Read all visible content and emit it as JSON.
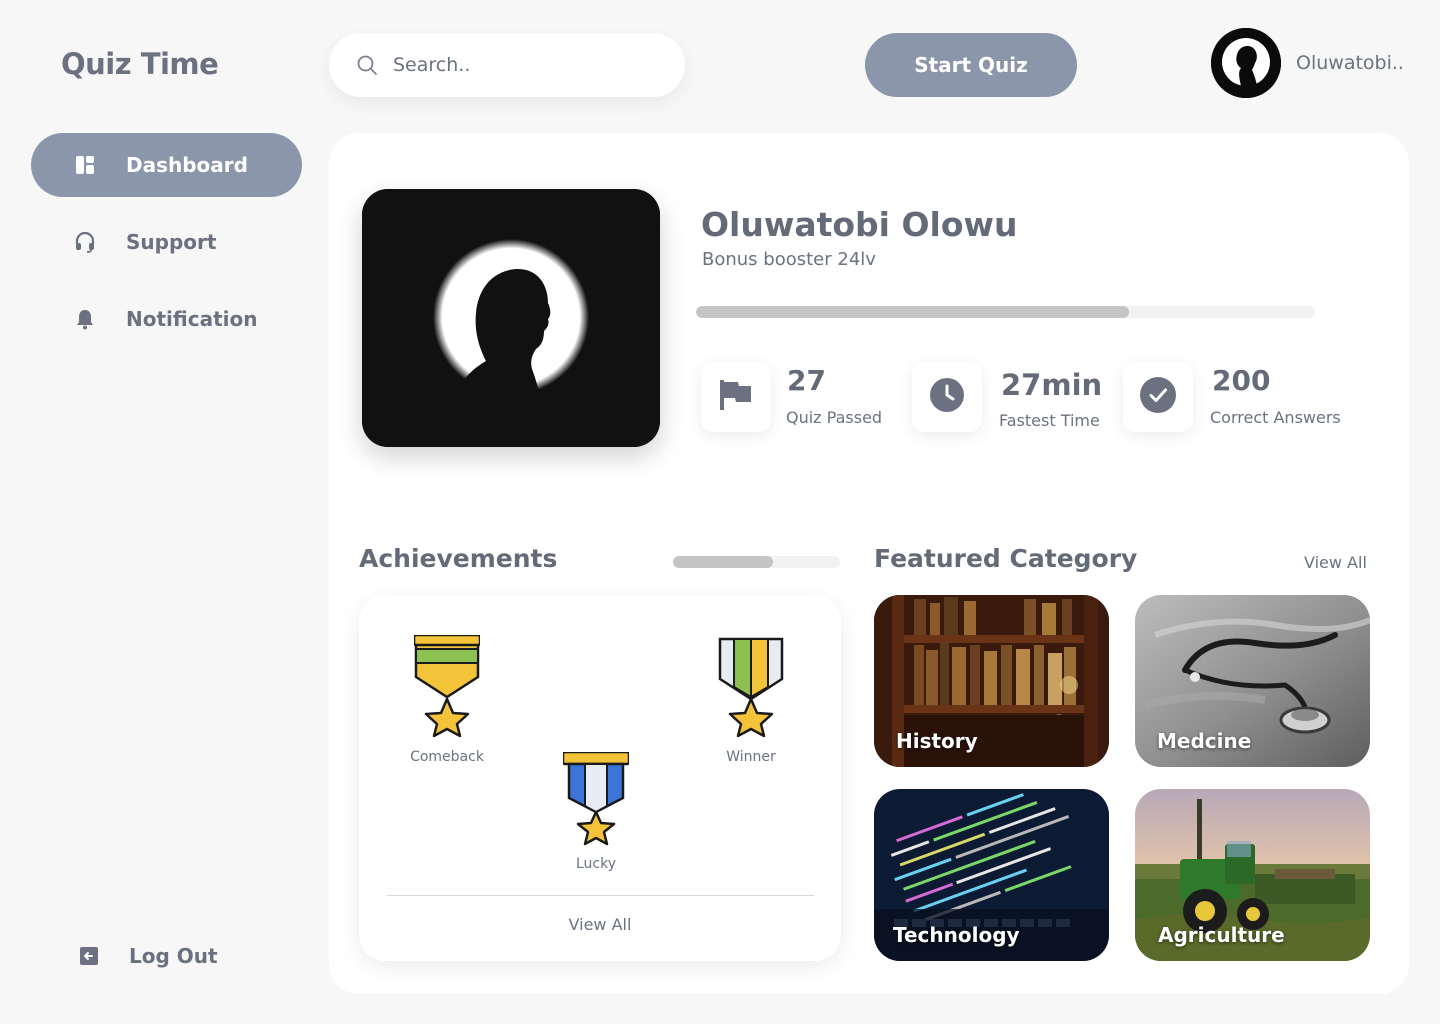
{
  "app": {
    "title": "Quiz Time"
  },
  "sidebar": {
    "items": [
      {
        "label": "Dashboard",
        "icon": "dashboard-icon",
        "active": true
      },
      {
        "label": "Support",
        "icon": "headset-icon",
        "active": false
      },
      {
        "label": "Notification",
        "icon": "bell-icon",
        "active": false
      }
    ],
    "logout_label": "Log Out"
  },
  "header": {
    "search": {
      "placeholder": "Search..",
      "value": ""
    },
    "start_quiz_label": "Start Quiz",
    "user_name": "Oluwatobi.."
  },
  "profile": {
    "name": "Oluwatobi Olowu",
    "subtitle": "Bonus booster 24lv",
    "progress": 0.7
  },
  "stats": [
    {
      "value": "27",
      "label": "Quiz Passed",
      "icon": "flag-icon"
    },
    {
      "value": "27min",
      "label": "Fastest Time",
      "icon": "clock-icon"
    },
    {
      "value": "200",
      "label": "Correct Answers",
      "icon": "check-circle-icon"
    }
  ],
  "achievements": {
    "title": "Achievements",
    "scroll_position": 0.6,
    "badges": [
      {
        "label": "Comeback",
        "icon": "medal-icon"
      },
      {
        "label": "Winner",
        "icon": "medal-icon"
      },
      {
        "label": "Lucky",
        "icon": "medal-icon"
      }
    ],
    "view_all_label": "View All"
  },
  "featured": {
    "title": "Featured Category",
    "view_all_label": "View All",
    "categories": [
      {
        "label": "History"
      },
      {
        "label": "Medcine"
      },
      {
        "label": "Technology"
      },
      {
        "label": "Agriculture"
      }
    ]
  },
  "colors": {
    "accent": "#8b96ab",
    "background": "#f8f7f8",
    "heading": "#646b78",
    "text": "#6b7280",
    "track": "#f2f2f2",
    "fill": "#c4c4c4"
  }
}
